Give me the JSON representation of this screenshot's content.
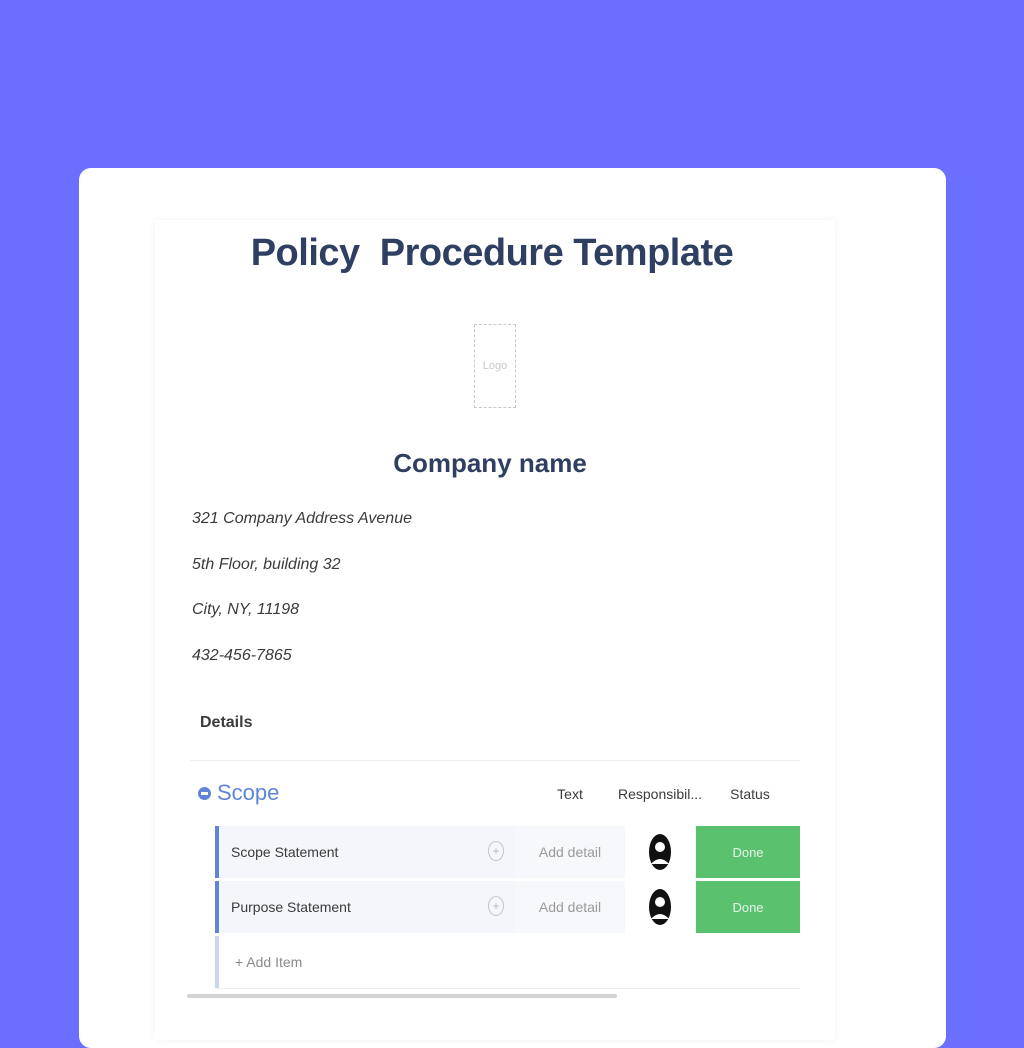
{
  "document": {
    "title": "Policy  Procedure Template",
    "logo_placeholder": "Logo",
    "company_name": "Company name",
    "address_lines": [
      "321 Company Address Avenue",
      "5th Floor, building 32",
      "City, NY, 11198",
      "432-456-7865"
    ]
  },
  "board": {
    "section_label": "Details",
    "group": {
      "name": "Scope",
      "color": "#5e86d6",
      "columns": [
        "Text",
        "Responsibil...",
        "Status"
      ]
    },
    "rows": [
      {
        "name": "Scope Statement",
        "text": "Add detail",
        "responsibility_icon": "person-avatar-icon",
        "status": "Done",
        "status_color": "#5ac26f"
      },
      {
        "name": "Purpose Statement",
        "text": "Add detail",
        "responsibility_icon": "person-avatar-icon",
        "status": "Done",
        "status_color": "#5ac26f"
      }
    ],
    "add_item_label": "+ Add Item"
  },
  "colors": {
    "background": "#6b6ffd",
    "heading": "#2f3f62"
  }
}
